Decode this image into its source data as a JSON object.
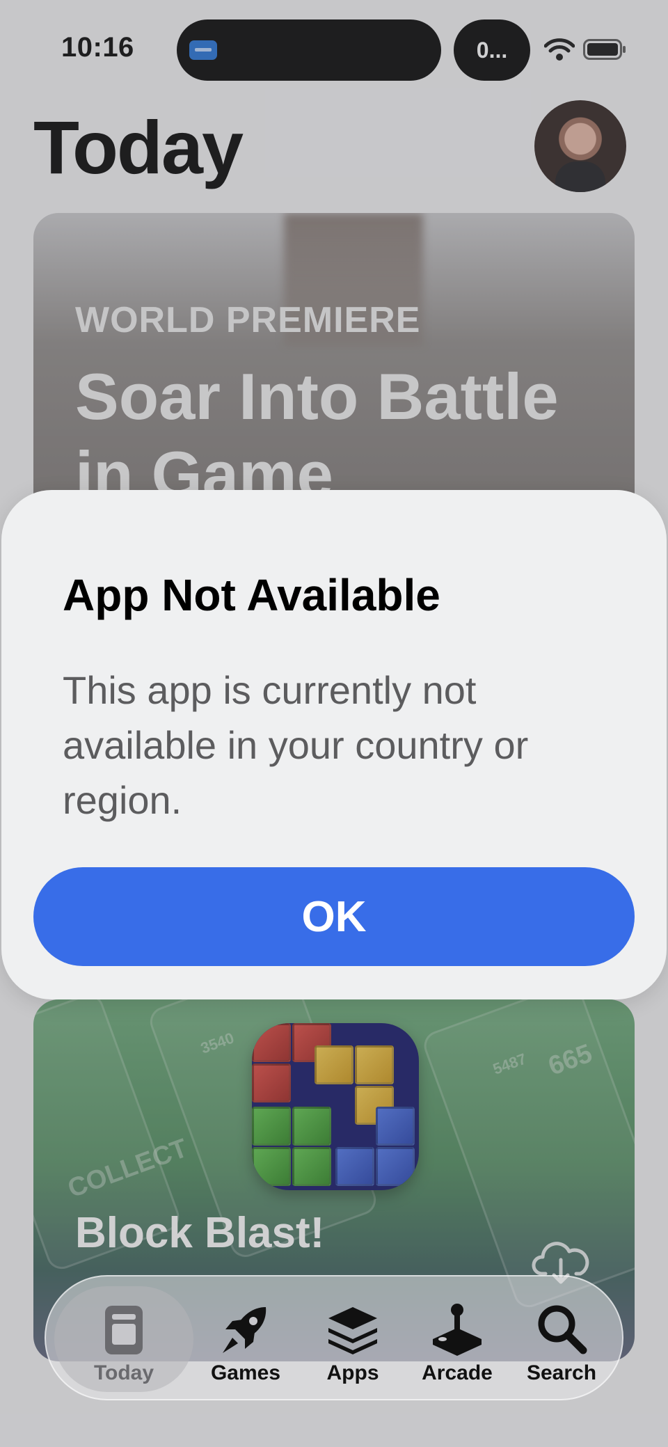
{
  "status_bar": {
    "time": "10:16",
    "live_activity_label": "0...",
    "icons": [
      "paypal-app-icon",
      "wifi-icon",
      "battery-icon"
    ]
  },
  "header": {
    "title": "Today",
    "avatar": "profile-avatar"
  },
  "feature_card": {
    "eyebrow": "WORLD PREMIERE",
    "headline": "Soar Into Battle in Game"
  },
  "game_card": {
    "title": "Block Blast!",
    "background_scores": [
      "3540",
      "5487",
      "665"
    ],
    "background_word": "COLLECT",
    "action_icon": "cloud-download-icon"
  },
  "alert": {
    "title": "App Not Available",
    "message": "This app is currently not available in your country or region.",
    "ok_label": "OK"
  },
  "tab_bar": {
    "tabs": [
      {
        "label": "Today",
        "icon": "today-icon",
        "active": true
      },
      {
        "label": "Games",
        "icon": "rocket-icon",
        "active": false
      },
      {
        "label": "Apps",
        "icon": "stack-icon",
        "active": false
      },
      {
        "label": "Arcade",
        "icon": "joystick-icon",
        "active": false
      },
      {
        "label": "Search",
        "icon": "search-icon",
        "active": false
      }
    ]
  },
  "colors": {
    "accent": "#386de8",
    "alert_background": "#eff0f1",
    "message_text": "#5c5c5e"
  }
}
